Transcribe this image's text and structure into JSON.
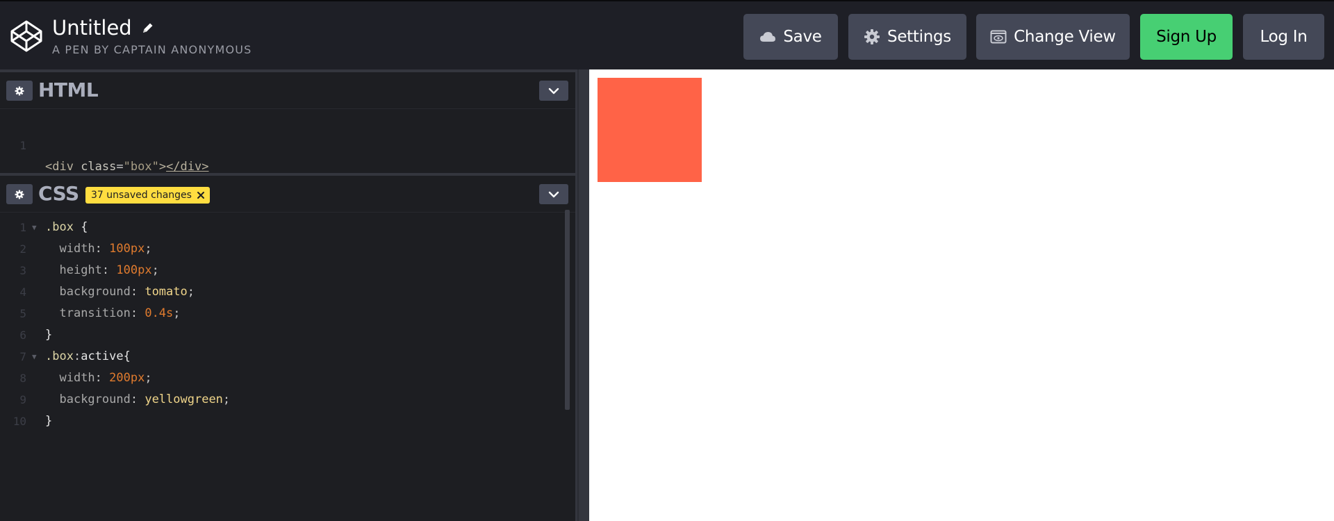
{
  "header": {
    "pen_title": "Untitled",
    "pen_subtitle": "A PEN BY CAPTAIN ANONYMOUS",
    "buttons": {
      "save": "Save",
      "settings": "Settings",
      "change_view": "Change View",
      "sign_up": "Sign Up",
      "log_in": "Log In"
    }
  },
  "html_editor": {
    "name": "HTML",
    "lines": [
      {
        "n": "1",
        "parts": [
          "<div",
          " class",
          "=",
          "\"box\"",
          ">",
          "</div>"
        ]
      }
    ]
  },
  "css_editor": {
    "name": "CSS",
    "badge": "37 unsaved changes",
    "lines": [
      {
        "n": "1",
        "fold": true,
        "code": ".box {"
      },
      {
        "n": "2",
        "fold": false,
        "code": "  width: 100px;"
      },
      {
        "n": "3",
        "fold": false,
        "code": "  height: 100px;"
      },
      {
        "n": "4",
        "fold": false,
        "code": "  background: tomato;"
      },
      {
        "n": "5",
        "fold": false,
        "code": "  transition: 0.4s;"
      },
      {
        "n": "6",
        "fold": false,
        "code": "}"
      },
      {
        "n": "7",
        "fold": true,
        "code": ".box:active{"
      },
      {
        "n": "8",
        "fold": false,
        "code": "  width: 200px;"
      },
      {
        "n": "9",
        "fold": false,
        "code": "  background: yellowgreen;"
      },
      {
        "n": "10",
        "fold": false,
        "code": "}"
      }
    ]
  },
  "icons": {
    "logo": "codepen-logo-icon",
    "pencil": "pencil-icon",
    "cloud": "cloud-icon",
    "gear": "gear-icon",
    "view": "eye-icon",
    "chevron": "chevron-down-icon",
    "close": "close-icon"
  },
  "colors": {
    "header_bg": "#1e1f26",
    "editor_bg": "#1d1e22",
    "button_bg": "#444857",
    "signup_bg": "#47cf73",
    "badge_bg": "#ffdd40",
    "preview_box": "#ff6347"
  }
}
